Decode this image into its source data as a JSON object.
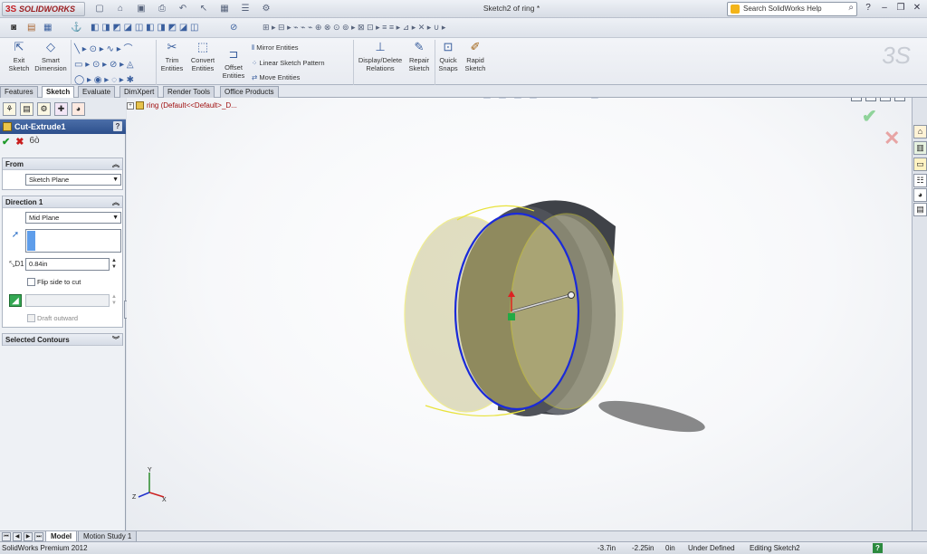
{
  "app": {
    "logo_text": "SOLIDWORKS",
    "document_title": "Sketch2 of ring *",
    "search_placeholder": "Search SolidWorks Help"
  },
  "ribbon": {
    "exit_sketch": "Exit Sketch",
    "smart_dimension": "Smart Dimension",
    "trim_entities": "Trim Entities",
    "convert_entities": "Convert Entities",
    "offset_entities": "Offset Entities",
    "mirror_entities": "Mirror Entities",
    "linear_sketch_pattern": "Linear Sketch Pattern",
    "move_entities": "Move Entities",
    "display_delete_relations": "Display/Delete Relations",
    "repair_sketch": "Repair Sketch",
    "quick_snaps": "Quick Snaps",
    "rapid_sketch": "Rapid Sketch"
  },
  "tabs": [
    "Features",
    "Sketch",
    "Evaluate",
    "DimXpert",
    "Render Tools",
    "Office Products"
  ],
  "feature_manager": {
    "title": "Cut-Extrude1",
    "help": "?",
    "from_header": "From",
    "from_value": "Sketch Plane",
    "direction_header": "Direction 1",
    "direction_value": "Mid Plane",
    "depth_value": "0.84in",
    "flip_side_label": "Flip side to cut",
    "draft_outward_label": "Draft outward",
    "selected_contours_header": "Selected Contours"
  },
  "viewport": {
    "tree_root": "ring  (Default<<Default>_D...",
    "triad_x": "X",
    "triad_y": "Y",
    "triad_z": "Z"
  },
  "bottom_tabs": [
    "Model",
    "Motion Study 1"
  ],
  "status": {
    "product": "SolidWorks Premium 2012",
    "x": "-3.7in",
    "y": "-2.25in",
    "z": "0in",
    "state": "Under Defined",
    "editing": "Editing Sketch2"
  },
  "colors": {
    "body_face": "#b6b07a",
    "body_dark": "#5c5f66",
    "edge_highlight": "#e8e23a",
    "sketch_circle": "#1a2ad9"
  }
}
